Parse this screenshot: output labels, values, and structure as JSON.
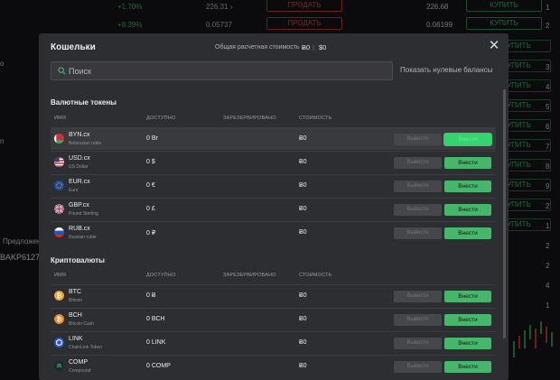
{
  "background": {
    "rows": [
      {
        "pct": "+1.70%",
        "price": "226.31 ›",
        "sell": "ПРОДАТЬ",
        "vol": "226.68",
        "buy": "КУПИТЬ"
      },
      {
        "pct": "+8.39%",
        "price": "0.05737",
        "sell": "ПРОДАТЬ",
        "vol": "0.06199",
        "buy": "КУПИТЬ"
      }
    ],
    "side_labels": [
      "o",
      "n",
      "Предложени",
      "BAKP6127"
    ],
    "right_buy": "УПИТЬ",
    "right_nums": [
      "1",
      "2",
      "3",
      "4",
      "5",
      "6",
      "7",
      "8",
      "9",
      "2",
      "1",
      "2",
      "2",
      "4",
      "1"
    ]
  },
  "modal": {
    "title": "Кошельки",
    "total_label": "Общая расчетная стоимость",
    "total_btc": "Ƀ0",
    "total_usd": "$0",
    "close_glyph": "✕",
    "search_placeholder": "Поиск",
    "show_zero_label": "Показать нулевые балансы",
    "columns": {
      "name": "ИМЯ",
      "available": "ДОСТУПНО",
      "reserved": "ЗАРЕЗЕРВИРОВАНО",
      "cost": "СТОИМОСТЬ"
    },
    "withdraw_label": "Вывести",
    "deposit_label": "Внести",
    "fiat": {
      "title": "Валютные токены",
      "rows": [
        {
          "ticker": "BYN.cx",
          "name": "Belarusian ruble",
          "available": "0 Br",
          "cost": "Ƀ0",
          "icon": "belarus-flag-icon"
        },
        {
          "ticker": "USD.cx",
          "name": "US Dollar",
          "available": "0 $",
          "cost": "Ƀ0",
          "icon": "us-flag-icon"
        },
        {
          "ticker": "EUR.cx",
          "name": "Euro",
          "available": "0 €",
          "cost": "Ƀ0",
          "icon": "eu-flag-icon"
        },
        {
          "ticker": "GBP.cx",
          "name": "Pound Sterling",
          "available": "0 £",
          "cost": "Ƀ0",
          "icon": "uk-flag-icon"
        },
        {
          "ticker": "RUB.cx",
          "name": "Russian ruble",
          "available": "0 ₽",
          "cost": "Ƀ0",
          "icon": "russia-flag-icon"
        }
      ]
    },
    "crypto": {
      "title": "Криптовалюты",
      "rows": [
        {
          "ticker": "BTC",
          "name": "Bitcoin",
          "available": "0 Ƀ",
          "cost": "Ƀ0",
          "icon": "bitcoin-icon"
        },
        {
          "ticker": "BCH",
          "name": "Bitcoin Cash",
          "available": "0 BCH",
          "cost": "Ƀ0",
          "icon": "bitcoin-cash-icon"
        },
        {
          "ticker": "LINK",
          "name": "ChainLink Token",
          "available": "0 LINK",
          "cost": "Ƀ0",
          "icon": "chainlink-icon"
        },
        {
          "ticker": "COMP",
          "name": "Compound",
          "available": "0 COMP",
          "cost": "Ƀ0",
          "icon": "compound-icon"
        }
      ]
    }
  },
  "colors": {
    "accent_green": "#47b56b",
    "sell_red": "#c23a3a",
    "modal_bg": "#2d2e31"
  }
}
